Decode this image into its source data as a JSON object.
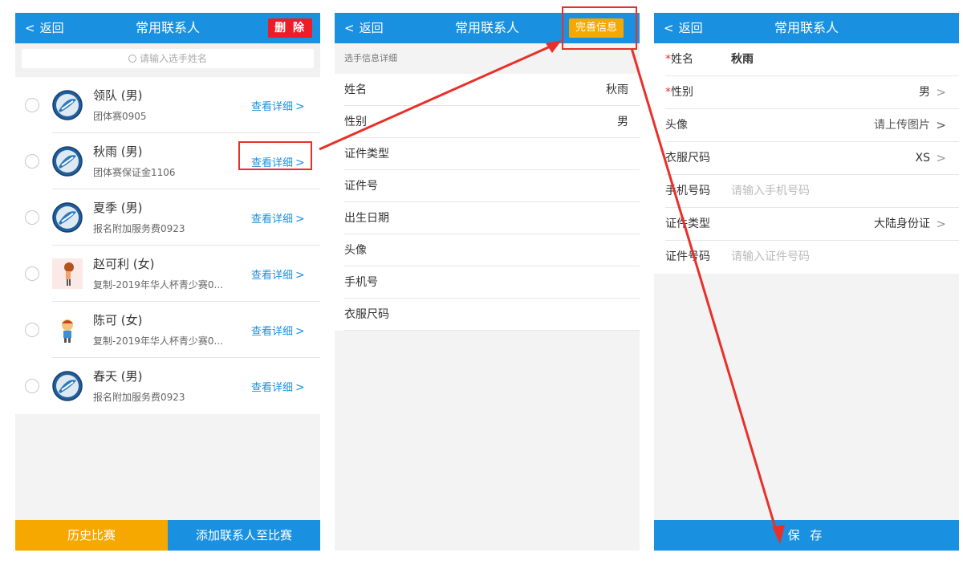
{
  "colors": {
    "primary": "#1a91e0",
    "orange": "#f7a800",
    "delete_red": "#ee1c25",
    "annotation_red": "#e8302a"
  },
  "panel1": {
    "back_label": "返回",
    "title": "常用联系人",
    "delete_label": "删 除",
    "search_placeholder": "请输入选手姓名",
    "contacts": [
      {
        "name": "领队 (男)",
        "group": "团体赛0905",
        "detail": "查看详细",
        "avatar_icon": "badminton-logo-icon"
      },
      {
        "name": "秋雨 (男)",
        "group": "团体赛保证金1106",
        "detail": "查看详细",
        "avatar_icon": "badminton-logo-icon"
      },
      {
        "name": "夏季 (男)",
        "group": "报名附加服务费0923",
        "detail": "查看详细",
        "avatar_icon": "badminton-logo-icon"
      },
      {
        "name": "赵可利 (女)",
        "group": "复制-2019年华人杯青少赛0...",
        "detail": "查看详细",
        "avatar_icon": "cartoon-girl-icon"
      },
      {
        "name": "陈可 (女)",
        "group": "复制-2019年华人杯青少赛0...",
        "detail": "查看详细",
        "avatar_icon": "cartoon-boy-icon"
      },
      {
        "name": "春天 (男)",
        "group": "报名附加服务费0923",
        "detail": "查看详细",
        "avatar_icon": "badminton-logo-icon"
      }
    ],
    "bottom_left": "历史比赛",
    "bottom_right": "添加联系人至比赛"
  },
  "panel2": {
    "back_label": "返回",
    "title": "常用联系人",
    "complete_label": "完善信息",
    "section_title": "选手信息详细",
    "fields": [
      {
        "label": "姓名",
        "value": "秋雨"
      },
      {
        "label": "性别",
        "value": "男"
      },
      {
        "label": "证件类型",
        "value": ""
      },
      {
        "label": "证件号",
        "value": ""
      },
      {
        "label": "出生日期",
        "value": ""
      },
      {
        "label": "头像",
        "value": ""
      },
      {
        "label": "手机号",
        "value": ""
      },
      {
        "label": "衣服尺码",
        "value": ""
      }
    ]
  },
  "panel3": {
    "back_label": "返回",
    "title": "常用联系人",
    "name_label": "姓名",
    "name_value": "秋雨",
    "gender_label": "性别",
    "gender_value": "男",
    "avatar_label": "头像",
    "avatar_value": "请上传图片",
    "size_label": "衣服尺码",
    "size_value": "XS",
    "phone_label": "手机号码",
    "phone_placeholder": "请输入手机号码",
    "idtype_label": "证件类型",
    "idtype_value": "大陆身份证",
    "idno_label": "证件号码",
    "idno_placeholder": "请输入证件号码",
    "required_mark": "*",
    "save_label": "保 存"
  }
}
